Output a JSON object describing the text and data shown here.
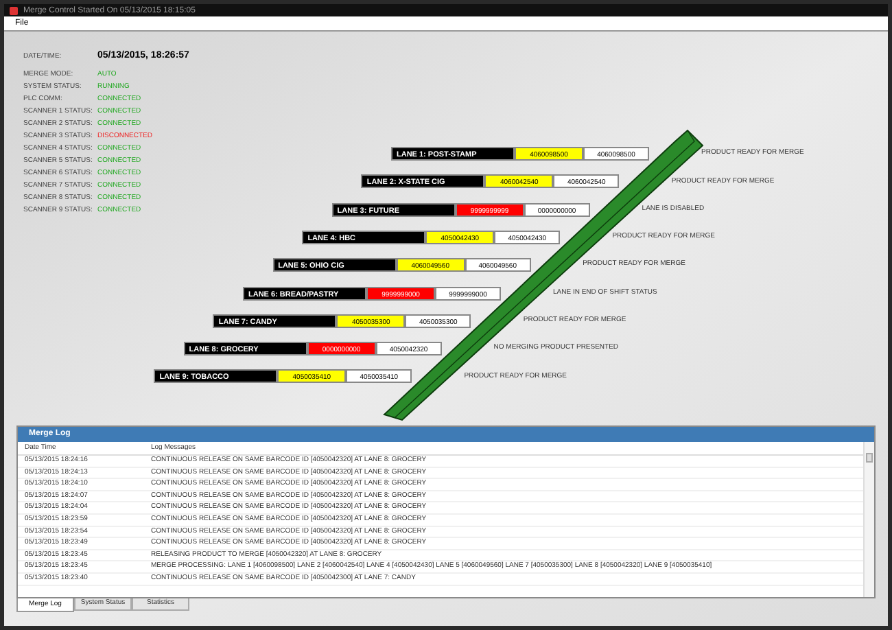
{
  "window": {
    "title": "Merge Control  Started On 05/13/2015 18:15:05"
  },
  "menu": [
    "File"
  ],
  "status": [
    {
      "label": "DATE/TIME:",
      "value": "05/13/2015, 18:26:57",
      "kind": "datetime"
    },
    {
      "label": "MERGE MODE:",
      "value": "AUTO",
      "color": "#22a822",
      "kind": "status"
    },
    {
      "label": "SYSTEM STATUS:",
      "value": "RUNNING",
      "color": "#22a822",
      "kind": "status"
    },
    {
      "label": "PLC COMM:",
      "value": "CONNECTED",
      "color": "#22a822",
      "kind": "status"
    },
    {
      "label": "SCANNER 1 STATUS:",
      "value": "CONNECTED",
      "color": "#22a822",
      "kind": "status"
    },
    {
      "label": "SCANNER 2 STATUS:",
      "value": "CONNECTED",
      "color": "#22a822",
      "kind": "status"
    },
    {
      "label": "SCANNER 3 STATUS:",
      "value": "DISCONNECTED",
      "color": "#ee2222",
      "kind": "status"
    },
    {
      "label": "SCANNER 4 STATUS:",
      "value": "CONNECTED",
      "color": "#22a822",
      "kind": "status"
    },
    {
      "label": "SCANNER 5 STATUS:",
      "value": "CONNECTED",
      "color": "#22a822",
      "kind": "status"
    },
    {
      "label": "SCANNER 6 STATUS:",
      "value": "CONNECTED",
      "color": "#22a822",
      "kind": "status"
    },
    {
      "label": "SCANNER 7 STATUS:",
      "value": "CONNECTED",
      "color": "#22a822",
      "kind": "status"
    },
    {
      "label": "SCANNER 8 STATUS:",
      "value": "CONNECTED",
      "color": "#22a822",
      "kind": "status"
    },
    {
      "label": "SCANNER 9 STATUS:",
      "value": "CONNECTED",
      "color": "#22a822",
      "kind": "status"
    }
  ],
  "lanes": [
    {
      "name": "LANE 1: POST-STAMP",
      "scanned": "4060098500",
      "color": "#ffff00",
      "barcode": "4060098500",
      "message": "PRODUCT READY FOR MERGE"
    },
    {
      "name": "LANE 2: X-STATE CIG",
      "scanned": "4060042540",
      "color": "#ffff00",
      "barcode": "4060042540",
      "message": "PRODUCT READY FOR MERGE"
    },
    {
      "name": "LANE 3: FUTURE",
      "scanned": "9999999999",
      "color": "#ff0000",
      "barcode": "0000000000",
      "message": "LANE IS DISABLED"
    },
    {
      "name": "LANE 4: HBC",
      "scanned": "4050042430",
      "color": "#ffff00",
      "barcode": "4050042430",
      "message": "PRODUCT READY FOR MERGE"
    },
    {
      "name": "LANE 5: OHIO CIG",
      "scanned": "4060049560",
      "color": "#ffff00",
      "barcode": "4060049560",
      "message": "PRODUCT READY FOR MERGE"
    },
    {
      "name": "LANE 6: BREAD/PASTRY",
      "scanned": "9999999000",
      "color": "#ff0000",
      "barcode": "9999999000",
      "message": "LANE IN END OF SHIFT STATUS"
    },
    {
      "name": "LANE 7: CANDY",
      "scanned": "4050035300",
      "color": "#ffff00",
      "barcode": "4050035300",
      "message": "PRODUCT READY FOR MERGE"
    },
    {
      "name": "LANE 8: GROCERY",
      "scanned": "0000000000",
      "color": "#ff0000",
      "barcode": "4050042320",
      "message": "NO MERGING PRODUCT PRESENTED"
    },
    {
      "name": "LANE 9: TOBACCO",
      "scanned": "4050035410",
      "color": "#ffff00",
      "barcode": "4050035410",
      "message": "PRODUCT READY FOR MERGE"
    }
  ],
  "log": {
    "title": "Merge Log",
    "columns": [
      "Date Time",
      "Log Messages"
    ],
    "rows": [
      [
        "05/13/2015 18:24:16",
        "CONTINUOUS RELEASE ON SAME BARCODE ID [4050042320] AT LANE 8: GROCERY"
      ],
      [
        "05/13/2015 18:24:13",
        "CONTINUOUS RELEASE ON SAME BARCODE ID [4050042320] AT LANE 8: GROCERY"
      ],
      [
        "05/13/2015 18:24:10",
        "CONTINUOUS RELEASE ON SAME BARCODE ID [4050042320] AT LANE 8: GROCERY"
      ],
      [
        "05/13/2015 18:24:07",
        "CONTINUOUS RELEASE ON SAME BARCODE ID [4050042320] AT LANE 8: GROCERY"
      ],
      [
        "05/13/2015 18:24:04",
        "CONTINUOUS RELEASE ON SAME BARCODE ID [4050042320] AT LANE 8: GROCERY"
      ],
      [
        "05/13/2015 18:23:59",
        "CONTINUOUS RELEASE ON SAME BARCODE ID [4050042320] AT LANE 8: GROCERY"
      ],
      [
        "05/13/2015 18:23:54",
        "CONTINUOUS RELEASE ON SAME BARCODE ID [4050042320] AT LANE 8: GROCERY"
      ],
      [
        "05/13/2015 18:23:49",
        "CONTINUOUS RELEASE ON SAME BARCODE ID [4050042320] AT LANE 8: GROCERY"
      ],
      [
        "05/13/2015 18:23:45",
        "RELEASING PRODUCT TO MERGE [4050042320] AT LANE 8: GROCERY"
      ],
      [
        "05/13/2015 18:23:45",
        "MERGE PROCESSING: LANE 1 [4060098500] LANE 2 [4060042540] LANE 4 [4050042430] LANE 5 [4060049560] LANE 7 [4050035300] LANE 8 [4050042320] LANE 9 [4050035410]"
      ],
      [
        "05/13/2015 18:23:40",
        "CONTINUOUS RELEASE ON SAME BARCODE ID [4050042300] AT LANE 7: CANDY"
      ]
    ]
  },
  "tabs": [
    {
      "label": "Merge Log",
      "selected": true
    },
    {
      "label": "System Status",
      "selected": false
    },
    {
      "label": "Statistics",
      "selected": false
    }
  ]
}
